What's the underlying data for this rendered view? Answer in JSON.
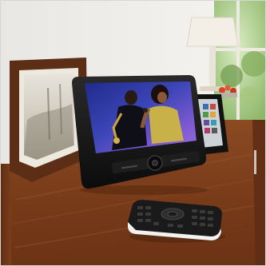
{
  "photo": {
    "subject": "portable-dvd-player-product-photo",
    "screen_content": "singer-and-saxophonist-on-stage",
    "colors": {
      "wall": "#eeece8",
      "wood_top": "#7a3f1c",
      "wood_front": "#6a3416",
      "frame": "#5a2d16",
      "device": "#141414",
      "screen_blue": "#2c3fa0",
      "screen_purple": "#8a5cd8",
      "window_green": "#8fbf6a",
      "lamp_shade": "#f2ede4",
      "remote_white": "#f4f4f4",
      "remote_black": "#1b1b1b"
    }
  }
}
